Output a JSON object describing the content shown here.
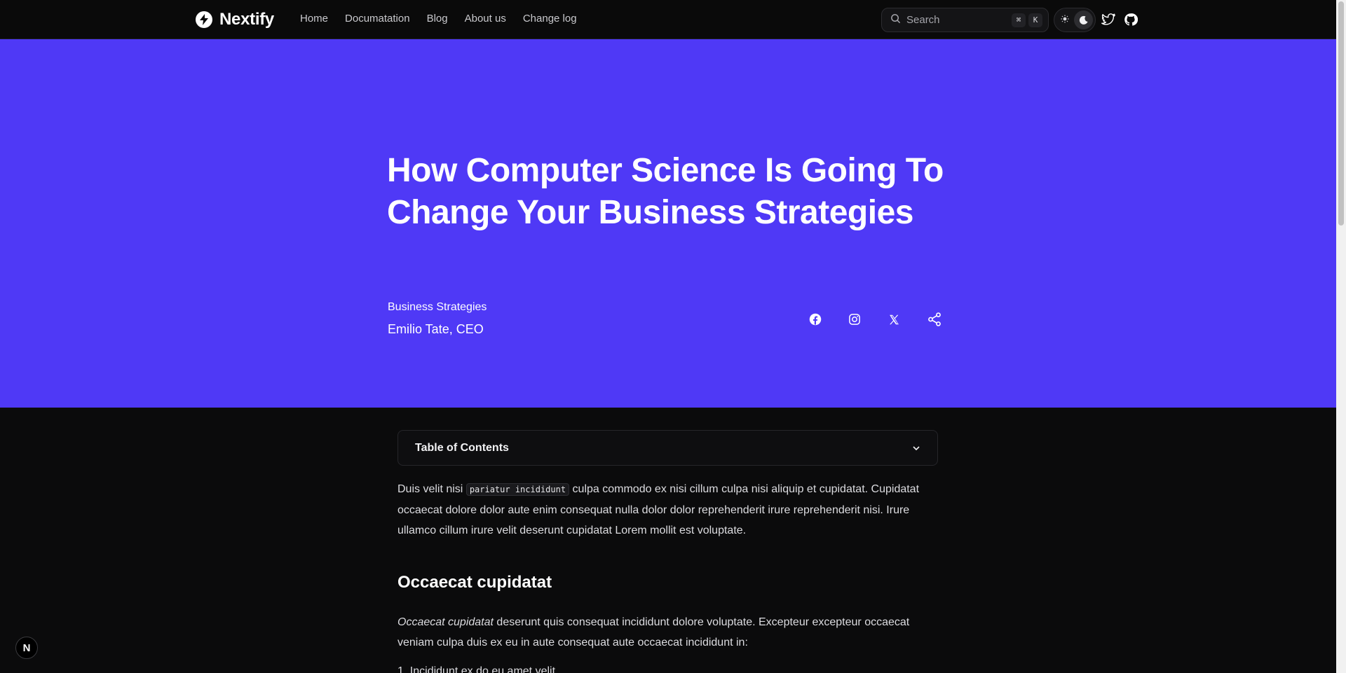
{
  "nav": {
    "brand": "Nextify",
    "links": [
      "Home",
      "Documatation",
      "Blog",
      "About us",
      "Change log"
    ],
    "search_placeholder": "Search",
    "kbd_cmd": "⌘",
    "kbd_k": "K"
  },
  "hero": {
    "title": "How Computer Science Is Going To Change Your Business Strategies",
    "category": "Business Strategies",
    "author": "Emilio Tate, CEO",
    "background": "#4f39f6"
  },
  "content": {
    "toc_title": "Table of Contents",
    "para1_pre": "Duis velit nisi ",
    "para1_code": "pariatur incididunt",
    "para1_post": " culpa commodo ex nisi cillum culpa nisi aliquip et cupidatat. Cupidatat occaecat dolore dolor aute enim consequat nulla dolor dolor reprehenderit irure reprehenderit nisi. Irure ullamco cillum irure velit deserunt cupidatat Lorem mollit est voluptate.",
    "heading": "Occaecat cupidatat",
    "para2_em": "Occaecat cupidatat",
    "para2_rest": " deserunt quis consequat incididunt dolore voluptate. Excepteur excepteur occaecat veniam culpa duis ex eu in aute consequat aute occaecat incididunt in:",
    "list_partial": "1. Incididunt ex do eu amet velit"
  },
  "badge": "N"
}
